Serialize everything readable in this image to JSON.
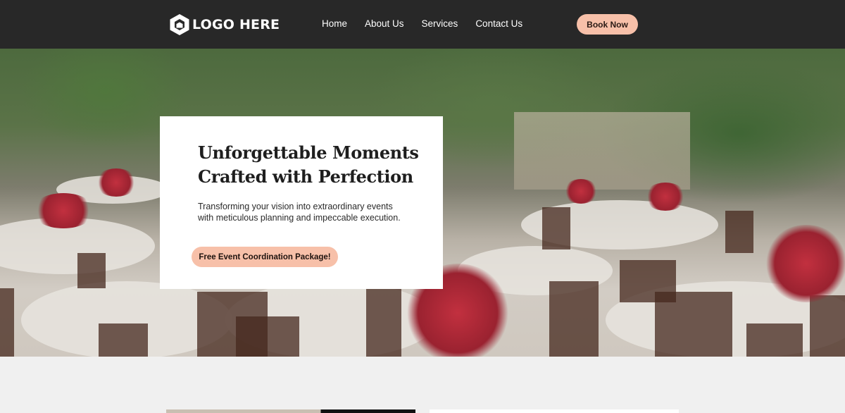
{
  "header": {
    "logo_text": "LOGO HERE",
    "nav": [
      "Home",
      "About Us",
      "Services",
      "Contact Us"
    ],
    "cta_label": "Book Now"
  },
  "hero": {
    "title_line1": "Unforgettable Moments",
    "title_line2": "Crafted with Perfection",
    "subtitle": "Transforming your vision into extraordinary events with meticulous planning and impeccable execution.",
    "cta_label": "Free Event Coordination Package!"
  },
  "colors": {
    "header_bg": "#282828",
    "accent": "#f7c0a9",
    "page_bg": "#f0f0f0"
  },
  "icons": {
    "logo": "hexagon-house-icon"
  }
}
